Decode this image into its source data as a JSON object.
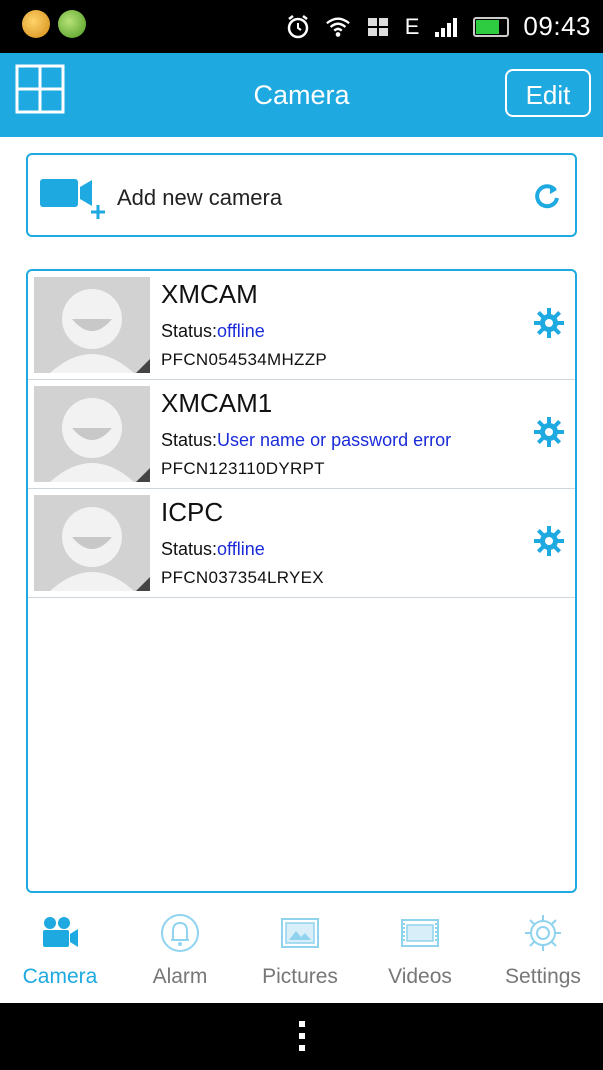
{
  "status_bar": {
    "network": "E",
    "time": "09:43"
  },
  "header": {
    "title": "Camera",
    "edit_label": "Edit"
  },
  "add_camera": {
    "label": "Add new camera"
  },
  "cameras": [
    {
      "name": "XMCAM",
      "status_label": "Status:",
      "status": "offline",
      "serial": "PFCN054534MHZZP"
    },
    {
      "name": "XMCAM1",
      "status_label": "Status:",
      "status": "User name or password error",
      "serial": "PFCN123110DYRPT"
    },
    {
      "name": "ICPC",
      "status_label": "Status:",
      "status": "offline",
      "serial": "PFCN037354LRYEX"
    }
  ],
  "bottom_nav": [
    {
      "label": "Camera",
      "icon": "camera-icon",
      "active": true
    },
    {
      "label": "Alarm",
      "icon": "bell-icon",
      "active": false
    },
    {
      "label": "Pictures",
      "icon": "picture-icon",
      "active": false
    },
    {
      "label": "Videos",
      "icon": "video-icon",
      "active": false
    },
    {
      "label": "Settings",
      "icon": "gear-icon",
      "active": false
    }
  ],
  "colors": {
    "accent": "#1ea9e0",
    "status_value": "#1a2bd8",
    "nav_inactive": "#777777"
  }
}
